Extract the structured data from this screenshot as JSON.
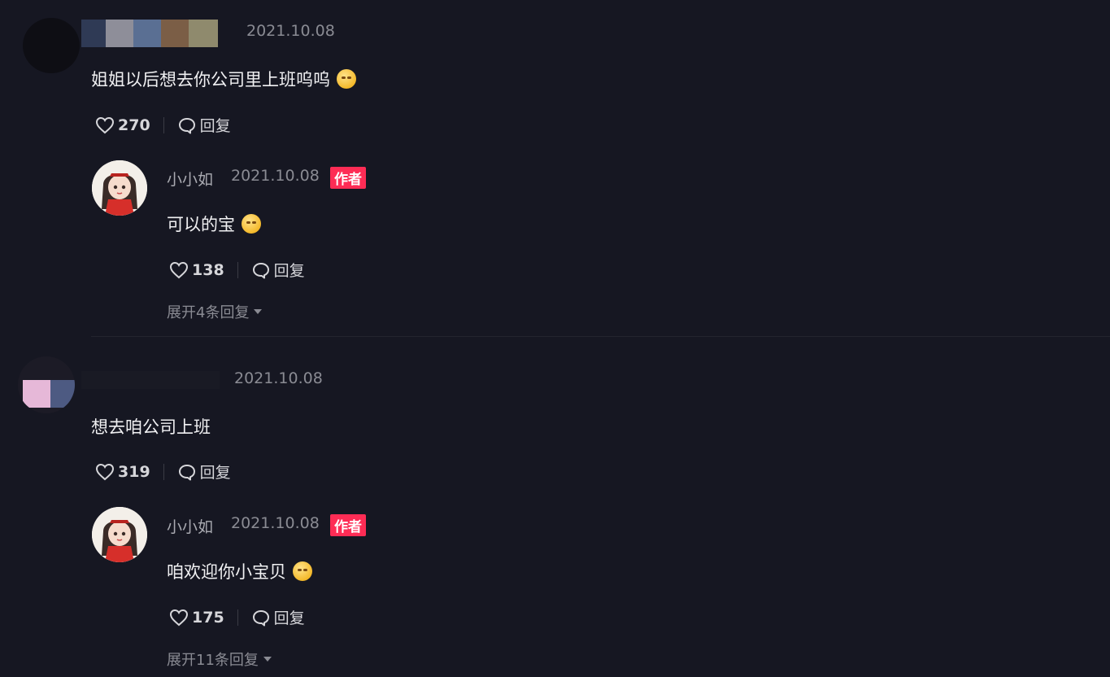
{
  "comments": [
    {
      "date": "2021.10.08",
      "text": "姐姐以后想去你公司里上班呜呜",
      "emoji": "pleading-face-emoji",
      "likes": "270",
      "reply_label": "回复",
      "author_reply": {
        "name": "小小如",
        "date": "2021.10.08",
        "badge": "作者",
        "text": "可以的宝",
        "emoji": "smirk-emoji",
        "likes": "138",
        "reply_label": "回复"
      },
      "expand_label": "展开4条回复"
    },
    {
      "date": "2021.10.08",
      "text": "想去咱公司上班",
      "likes": "319",
      "reply_label": "回复",
      "author_reply": {
        "name": "小小如",
        "date": "2021.10.08",
        "badge": "作者",
        "text": "咱欢迎你小宝贝",
        "emoji": "thinking-face-emoji",
        "likes": "175",
        "reply_label": "回复"
      },
      "expand_label": "展开11条回复"
    }
  ],
  "colors": {
    "background": "#161722",
    "badge": "#fe2c55",
    "muted_text": "#8a8b93",
    "primary_text": "#f0f0f2"
  }
}
